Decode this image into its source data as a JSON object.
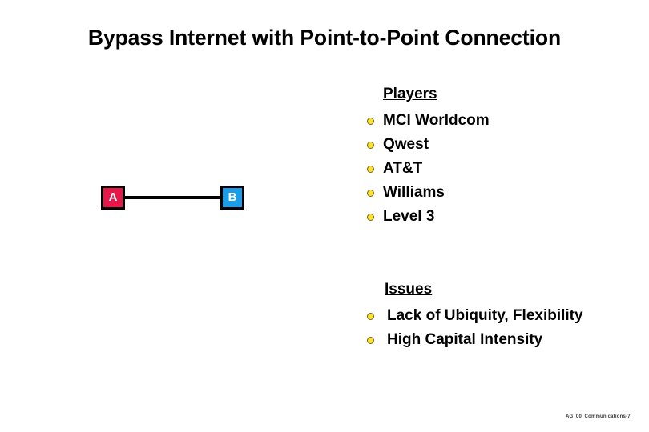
{
  "slide": {
    "title": "Bypass Internet with Point-to-Point Connection",
    "background_color": "#ffffff",
    "footer": "AG_00_Communications-7"
  },
  "diagram": {
    "node_a": {
      "label": "A",
      "color": "#e8174a"
    },
    "node_b": {
      "label": "B",
      "color": "#1c9ce8"
    },
    "connector_color": "#000000"
  },
  "players": {
    "heading": "Players",
    "bullet_color": "#ffe033",
    "items": [
      {
        "label": "MCI Worldcom"
      },
      {
        "label": "Qwest"
      },
      {
        "label": "AT&T"
      },
      {
        "label": "Williams"
      },
      {
        "label": "Level 3"
      }
    ]
  },
  "issues": {
    "heading": "Issues",
    "bullet_color": "#ffe033",
    "items": [
      {
        "label": "Lack of Ubiquity, Flexibility"
      },
      {
        "label": "High Capital Intensity"
      }
    ]
  }
}
